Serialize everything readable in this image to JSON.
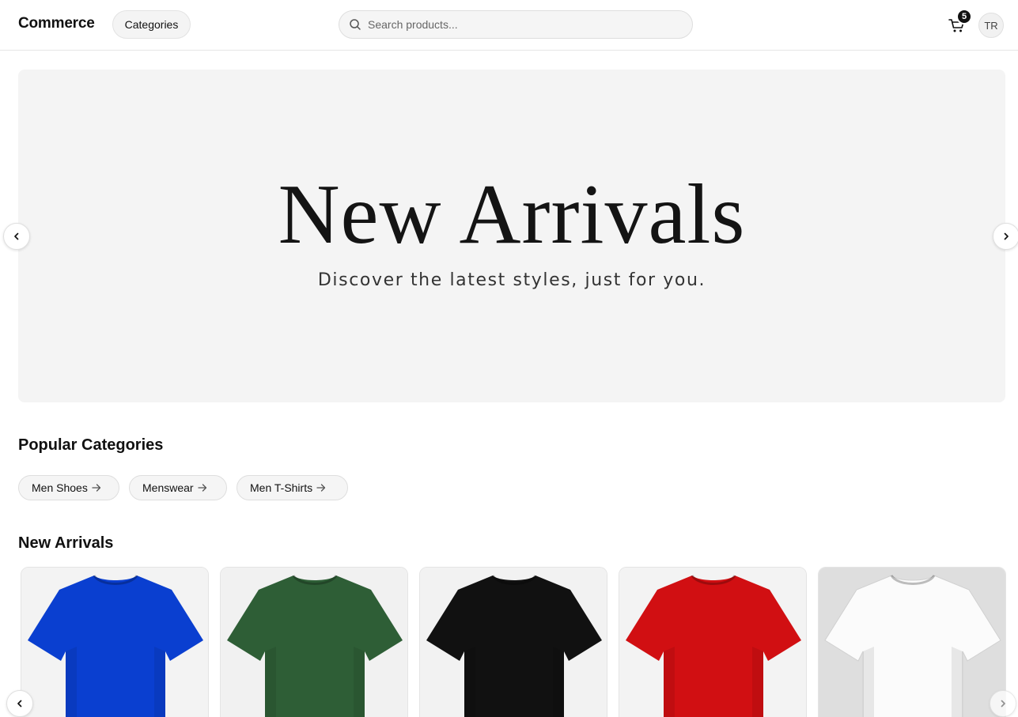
{
  "header": {
    "brand": "Commerce",
    "categories_label": "Categories",
    "search_placeholder": "Search products...",
    "cart_count": "5",
    "avatar_initials": "TR"
  },
  "hero": {
    "title": "New Arrivals",
    "subtitle": "Discover the latest styles, just for you."
  },
  "popular": {
    "title": "Popular Categories",
    "chips": [
      {
        "label": "Men Shoes"
      },
      {
        "label": "Menswear"
      },
      {
        "label": "Men T-Shirts"
      }
    ]
  },
  "arrivals": {
    "title": "New Arrivals",
    "products": [
      {
        "color": "#0a3fd0",
        "bg": "#f3f3f3",
        "icon": "blue-tshirt"
      },
      {
        "color": "#2e5e36",
        "bg": "#f1f1f1",
        "icon": "green-tshirt"
      },
      {
        "color": "#111111",
        "bg": "#f2f2f2",
        "icon": "black-tshirt"
      },
      {
        "color": "#d10f12",
        "bg": "#f3f3f3",
        "icon": "red-tshirt"
      },
      {
        "color": "#fbfbfb",
        "bg": "#dedede",
        "icon": "white-tshirt"
      }
    ]
  }
}
